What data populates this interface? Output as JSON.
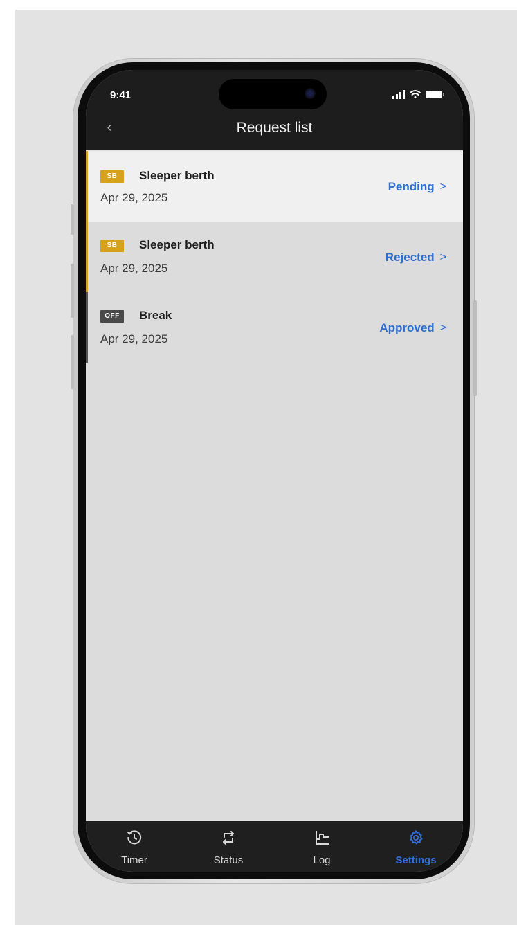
{
  "status_bar": {
    "time": "9:41"
  },
  "header": {
    "title": "Request list",
    "back_icon": "chevron-left-icon"
  },
  "requests": [
    {
      "badge": "SB",
      "type": "Sleeper berth",
      "date": "Apr 29, 2025",
      "status": "Pending"
    },
    {
      "badge": "SB",
      "type": "Sleeper berth",
      "date": "Apr 29, 2025",
      "status": "Rejected"
    },
    {
      "badge": "OFF",
      "type": "Break",
      "date": "Apr 29, 2025",
      "status": "Approved"
    }
  ],
  "nav": {
    "items": [
      {
        "label": "Timer",
        "icon": "clock-icon"
      },
      {
        "label": "Status",
        "icon": "switch-icon"
      },
      {
        "label": "Log",
        "icon": "log-graph-icon"
      },
      {
        "label": "Settings",
        "icon": "gear-icon"
      }
    ],
    "active": "Settings"
  },
  "colors": {
    "accent_sb": "#d5a21a",
    "link": "#2d6fcf",
    "header_bg": "#1d1d1d",
    "active_nav": "#2f6fdc"
  }
}
